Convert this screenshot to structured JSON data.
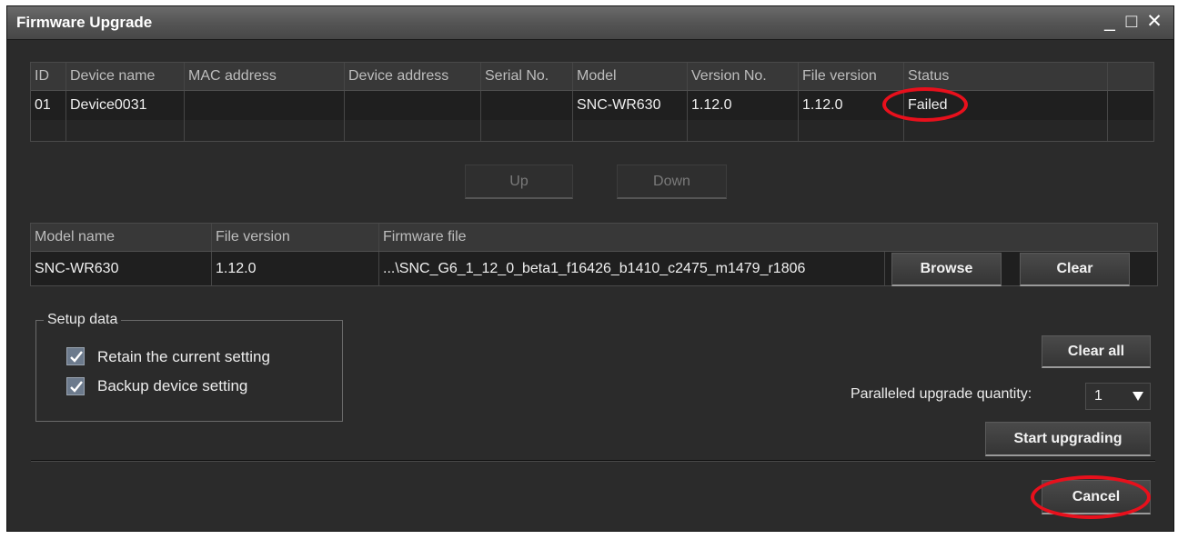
{
  "window": {
    "title": "Firmware Upgrade",
    "minimize_glyph": "_",
    "maximize_glyph": "□",
    "close_glyph": "✕"
  },
  "device_table": {
    "columns": [
      "ID",
      "Device name",
      "MAC address",
      "Device address",
      "Serial No.",
      "Model",
      "Version No.",
      "File version",
      "Status"
    ],
    "rows": [
      {
        "id": "01",
        "device_name": "Device0031",
        "mac_address": "",
        "device_address": "",
        "serial_no": "",
        "model": "SNC-WR630",
        "version_no": "1.12.0",
        "file_version": "1.12.0",
        "status": "Failed"
      }
    ]
  },
  "order_buttons": {
    "up": "Up",
    "down": "Down"
  },
  "firmware_table": {
    "columns": [
      "Model name",
      "File version",
      "Firmware file"
    ],
    "rows": [
      {
        "model_name": "SNC-WR630",
        "file_version": "1.12.0",
        "firmware_file": "...\\SNC_G6_1_12_0_beta1_f16426_b1410_c2475_m1479_r1806"
      }
    ],
    "browse_label": "Browse",
    "clear_label": "Clear"
  },
  "setup_data": {
    "legend": "Setup data",
    "options": [
      {
        "label": "Retain the current setting",
        "checked": true
      },
      {
        "label": "Backup device setting",
        "checked": true
      }
    ]
  },
  "actions": {
    "clear_all": "Clear all",
    "parallel_label": "Paralleled upgrade quantity:",
    "parallel_value": "1",
    "start": "Start upgrading",
    "cancel": "Cancel"
  },
  "colors": {
    "highlight_ring": "#e8101c",
    "background": "#2b2b2b"
  },
  "icons": {
    "dropdown": "triangle-down-icon",
    "check": "checkmark-icon"
  }
}
